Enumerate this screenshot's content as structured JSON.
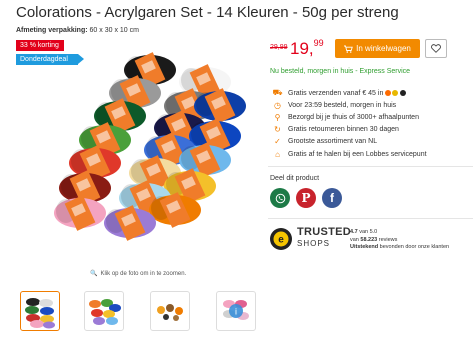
{
  "product": {
    "title": "Colorations - Acrylgaren Set - 14 Kleuren - 50g per streng",
    "dims_label": "Afmeting verpakking:",
    "dims_value": "60 x 30 x 10 cm",
    "badges": {
      "discount": "33 % korting",
      "deal": "Donderdagdeal"
    },
    "zoom_hint": "Klik op de foto om in te zoomen.",
    "image_icon": "yarn-bundle-photo"
  },
  "price": {
    "old": "29,99",
    "new_main": "19,",
    "new_cents": "99",
    "cart_label": "In winkelwagen",
    "cart_icon": "cart-icon",
    "wishlist_icon": "heart-icon"
  },
  "delivery": "Nu besteld, morgen in huis - Express Service",
  "usps": [
    {
      "icon": "truck-icon",
      "text": "Gratis verzenden vanaf € 45 in"
    },
    {
      "icon": "clock-icon",
      "text": "Voor 23:59 besteld, morgen in huis"
    },
    {
      "icon": "location-icon",
      "text": "Bezorgd bij je thuis of 3000+ afhaalpunten"
    },
    {
      "icon": "return-icon",
      "text": "Gratis retourneren binnen 30 dagen"
    },
    {
      "icon": "check-icon",
      "text": "Grootste assortiment van NL"
    },
    {
      "icon": "store-icon",
      "text": "Gratis af te halen bij een Lobbes servicepunt"
    }
  ],
  "flags": [
    "#ff6b00",
    "#e8b800",
    "#222222"
  ],
  "share": {
    "label": "Deel dit product",
    "networks": [
      {
        "name": "whatsapp",
        "color": "#1d7a47"
      },
      {
        "name": "pinterest",
        "color": "#c8232c"
      },
      {
        "name": "facebook",
        "color": "#3b5998"
      }
    ]
  },
  "trusted_shops": {
    "name": "TRUSTED",
    "shops": "SHOPS",
    "rating": "4.7",
    "rating_suffix": "van 5.0",
    "reviews_count": "58.223",
    "reviews_suffix": "reviews",
    "verdict": "Uitstekend",
    "verdict_suffix": "bevonden door onze klanten"
  },
  "thumbnails": [
    {
      "alt": "thumb-yarn-bundle",
      "active": true
    },
    {
      "alt": "thumb-yarn-bundle-2",
      "active": false
    },
    {
      "alt": "thumb-crochet-animals",
      "active": false
    },
    {
      "alt": "thumb-more-images",
      "active": false
    }
  ],
  "colors": {
    "accent": "#f28a00",
    "price": "#e2001a",
    "delivery": "#2f9e2f",
    "deal": "#1f9bde"
  }
}
